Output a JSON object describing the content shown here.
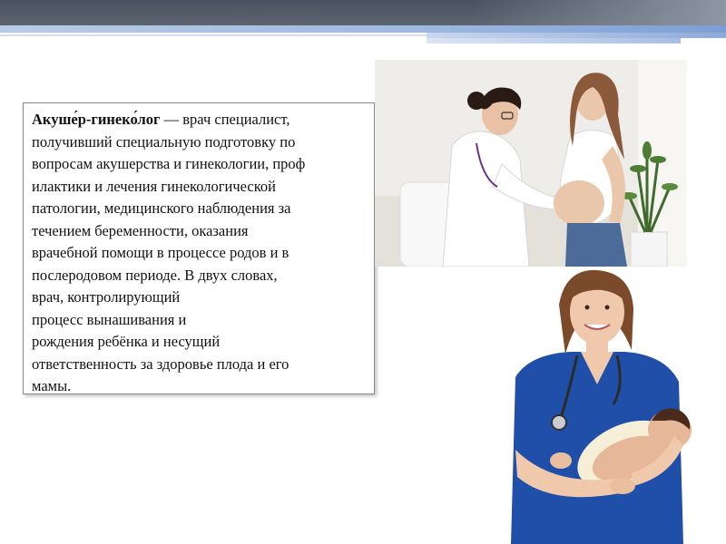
{
  "slide": {
    "term": "Акуше́р-гинеко́лог",
    "body_lines": [
      " — врач специалист,",
      "получивший специальную подготовку по",
      "вопросам акушерства и гинекологии, проф",
      "илактики и лечения гинекологической",
      "патологии, медицинского наблюдения за",
      "течением беременности, оказания",
      "врачебной помощи в процессе родов и в",
      "послеродовом периоде. В двух словах,",
      "врач, контролирующий",
      "процесс вынашивания и",
      "рождения ребёнка и несущий",
      "ответственность за здоровье плода и его",
      "мамы."
    ]
  },
  "images": {
    "photo_1": "doctor-examining-pregnant-woman",
    "photo_2": "nurse-holding-newborn"
  },
  "colors": {
    "top_band": "#4a5260",
    "stripe_blue": "#9db7de",
    "scrubs_blue": "#1f4fa8",
    "text": "#111111"
  }
}
